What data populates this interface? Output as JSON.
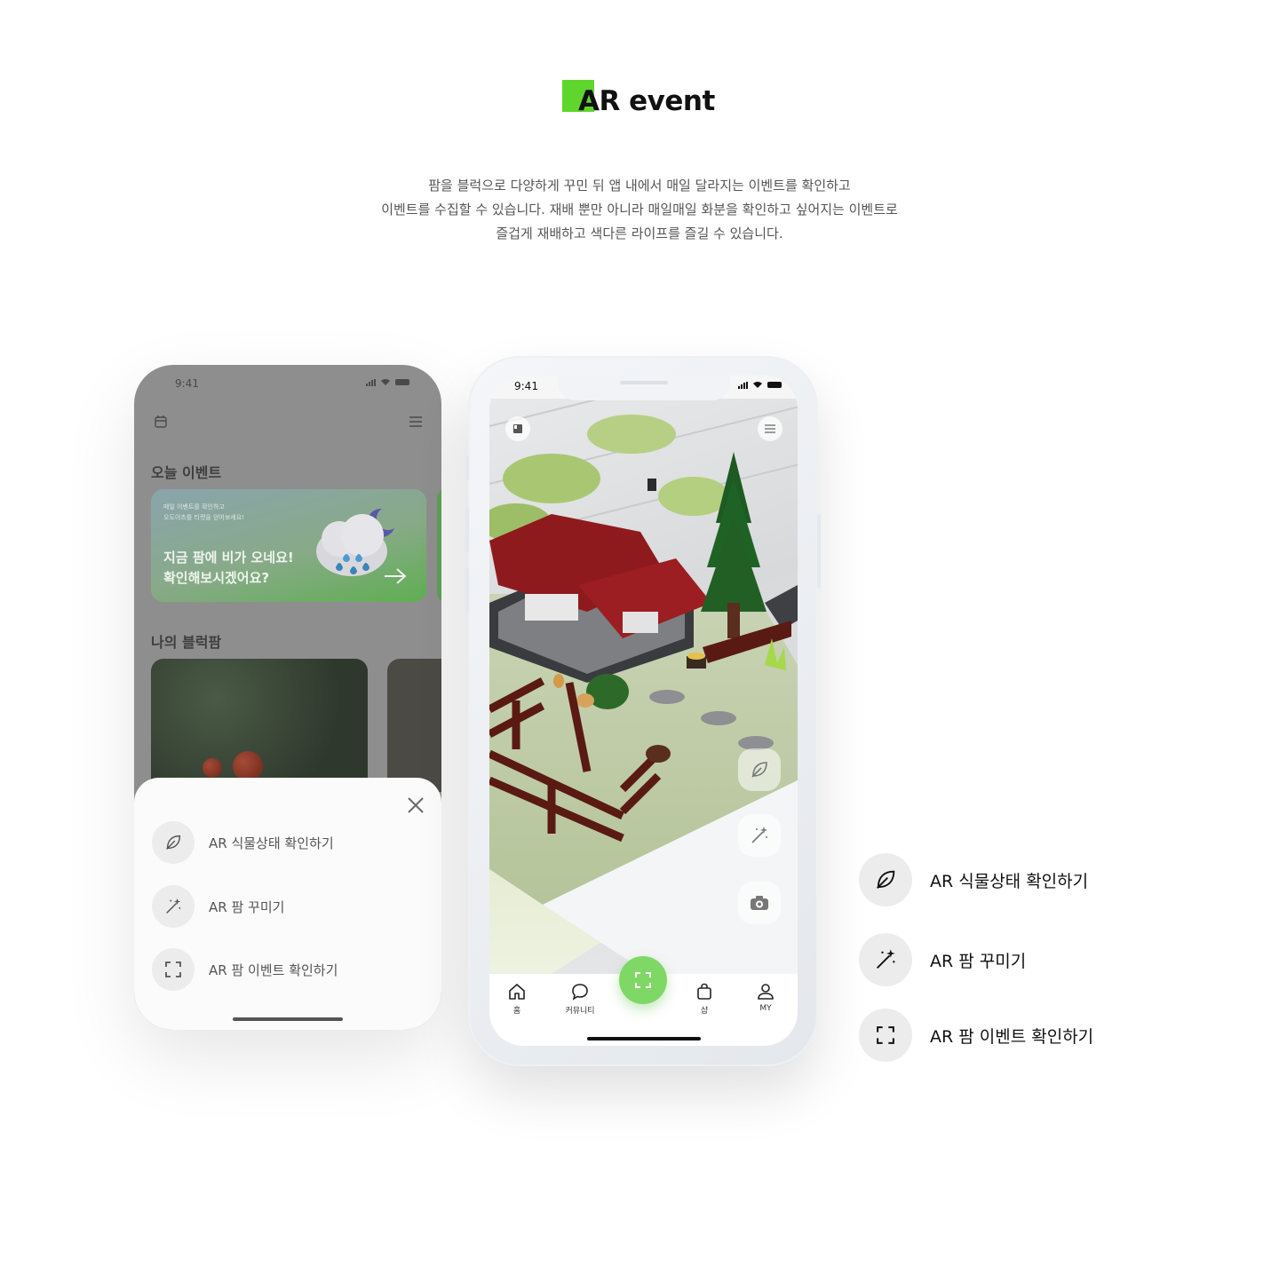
{
  "header": {
    "title": "AR event",
    "accent_color": "#5ed62c",
    "description": [
      "팜을 블럭으로 다양하게 꾸민 뒤 앱 내에서 매일 달라지는 이벤트를 확인하고",
      "이벤트를 수집할 수 있습니다. 재배 뿐만 아니라 매일매일 화분을 확인하고 싶어지는 이벤트로",
      "즐겁게 재배하고 색다른 라이프를 즐길 수 있습니다."
    ]
  },
  "left_phone": {
    "status": {
      "time": "9:41"
    },
    "today_event_title": "오늘 이벤트",
    "event_card": {
      "small_text": [
        "매일 이벤트를 확인하고",
        "오도이츠를 티켓을 얻어보세요!"
      ],
      "headline": [
        "지금 팜에 비가 오네요!",
        "확인해보시겠어요?"
      ]
    },
    "my_farm_title": "나의 블럭팜",
    "sheet": {
      "items": [
        {
          "icon": "leaf-icon",
          "label": "AR 식물상태 확인하기"
        },
        {
          "icon": "magic-wand-icon",
          "label": "AR 팜 꾸미기"
        },
        {
          "icon": "scan-frame-icon",
          "label": "AR 팜 이벤트 확인하기"
        }
      ]
    }
  },
  "right_phone": {
    "status": {
      "time": "9:41"
    },
    "tabs": [
      {
        "icon": "home-icon",
        "label": "홈"
      },
      {
        "icon": "chat-bubble-icon",
        "label": "커뮤니티"
      },
      {
        "icon": "shopping-bag-icon",
        "label": "샵"
      },
      {
        "icon": "user-icon",
        "label": "MY"
      }
    ],
    "center_button_color": "#7fd866"
  },
  "legend": {
    "items": [
      {
        "icon": "leaf-icon",
        "label": "AR 식물상태 확인하기"
      },
      {
        "icon": "magic-wand-icon",
        "label": "AR 팜 꾸미기"
      },
      {
        "icon": "scan-frame-icon",
        "label": "AR 팜 이벤트 확인하기"
      }
    ]
  }
}
